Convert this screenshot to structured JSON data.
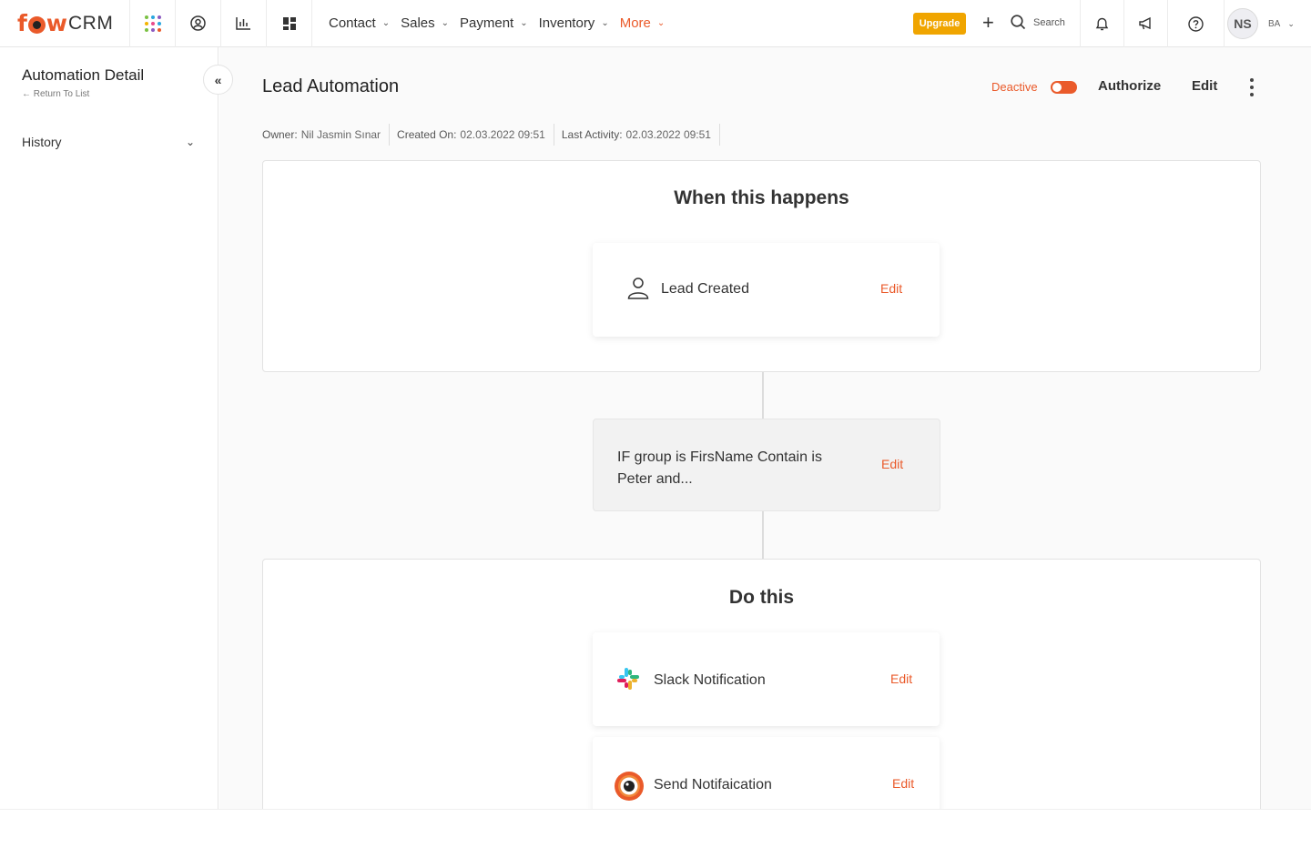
{
  "app": {
    "logo_prefix": "f",
    "logo_mid": "w",
    "logo_suffix": "CRM"
  },
  "topnav": {
    "items": [
      {
        "label": "Contact"
      },
      {
        "label": "Sales"
      },
      {
        "label": "Payment"
      },
      {
        "label": "Inventory"
      },
      {
        "label": "More"
      }
    ],
    "upgrade_label": "Upgrade",
    "search_label": "Search",
    "user_initials": "NS",
    "user_org": "BA"
  },
  "sidebar": {
    "title": "Automation Detail",
    "return_label": "Return To List",
    "history_label": "History"
  },
  "page": {
    "title": "Lead Automation",
    "status_label": "Deactive",
    "authorize_label": "Authorize",
    "edit_label": "Edit",
    "meta": {
      "owner_key": "Owner:",
      "owner_value": "Nil Jasmin Sınar",
      "created_key": "Created On:",
      "created_value": "02.03.2022 09:51",
      "activity_key": "Last Activity:",
      "activity_value": "02.03.2022 09:51"
    }
  },
  "trigger": {
    "section_title": "When this happens",
    "card_label": "Lead Created",
    "edit_label": "Edit"
  },
  "condition": {
    "text": "IF group is FirsName Contain is Peter and...",
    "edit_label": "Edit"
  },
  "actions": {
    "section_title": "Do this",
    "items": [
      {
        "label": "Slack Notification",
        "edit_label": "Edit",
        "icon": "slack-icon"
      },
      {
        "label": "Send Notifaication",
        "edit_label": "Edit",
        "icon": "fowcrm-eye-icon"
      }
    ]
  },
  "colors": {
    "accent": "#ea5a2a",
    "upgrade": "#f0a500"
  }
}
